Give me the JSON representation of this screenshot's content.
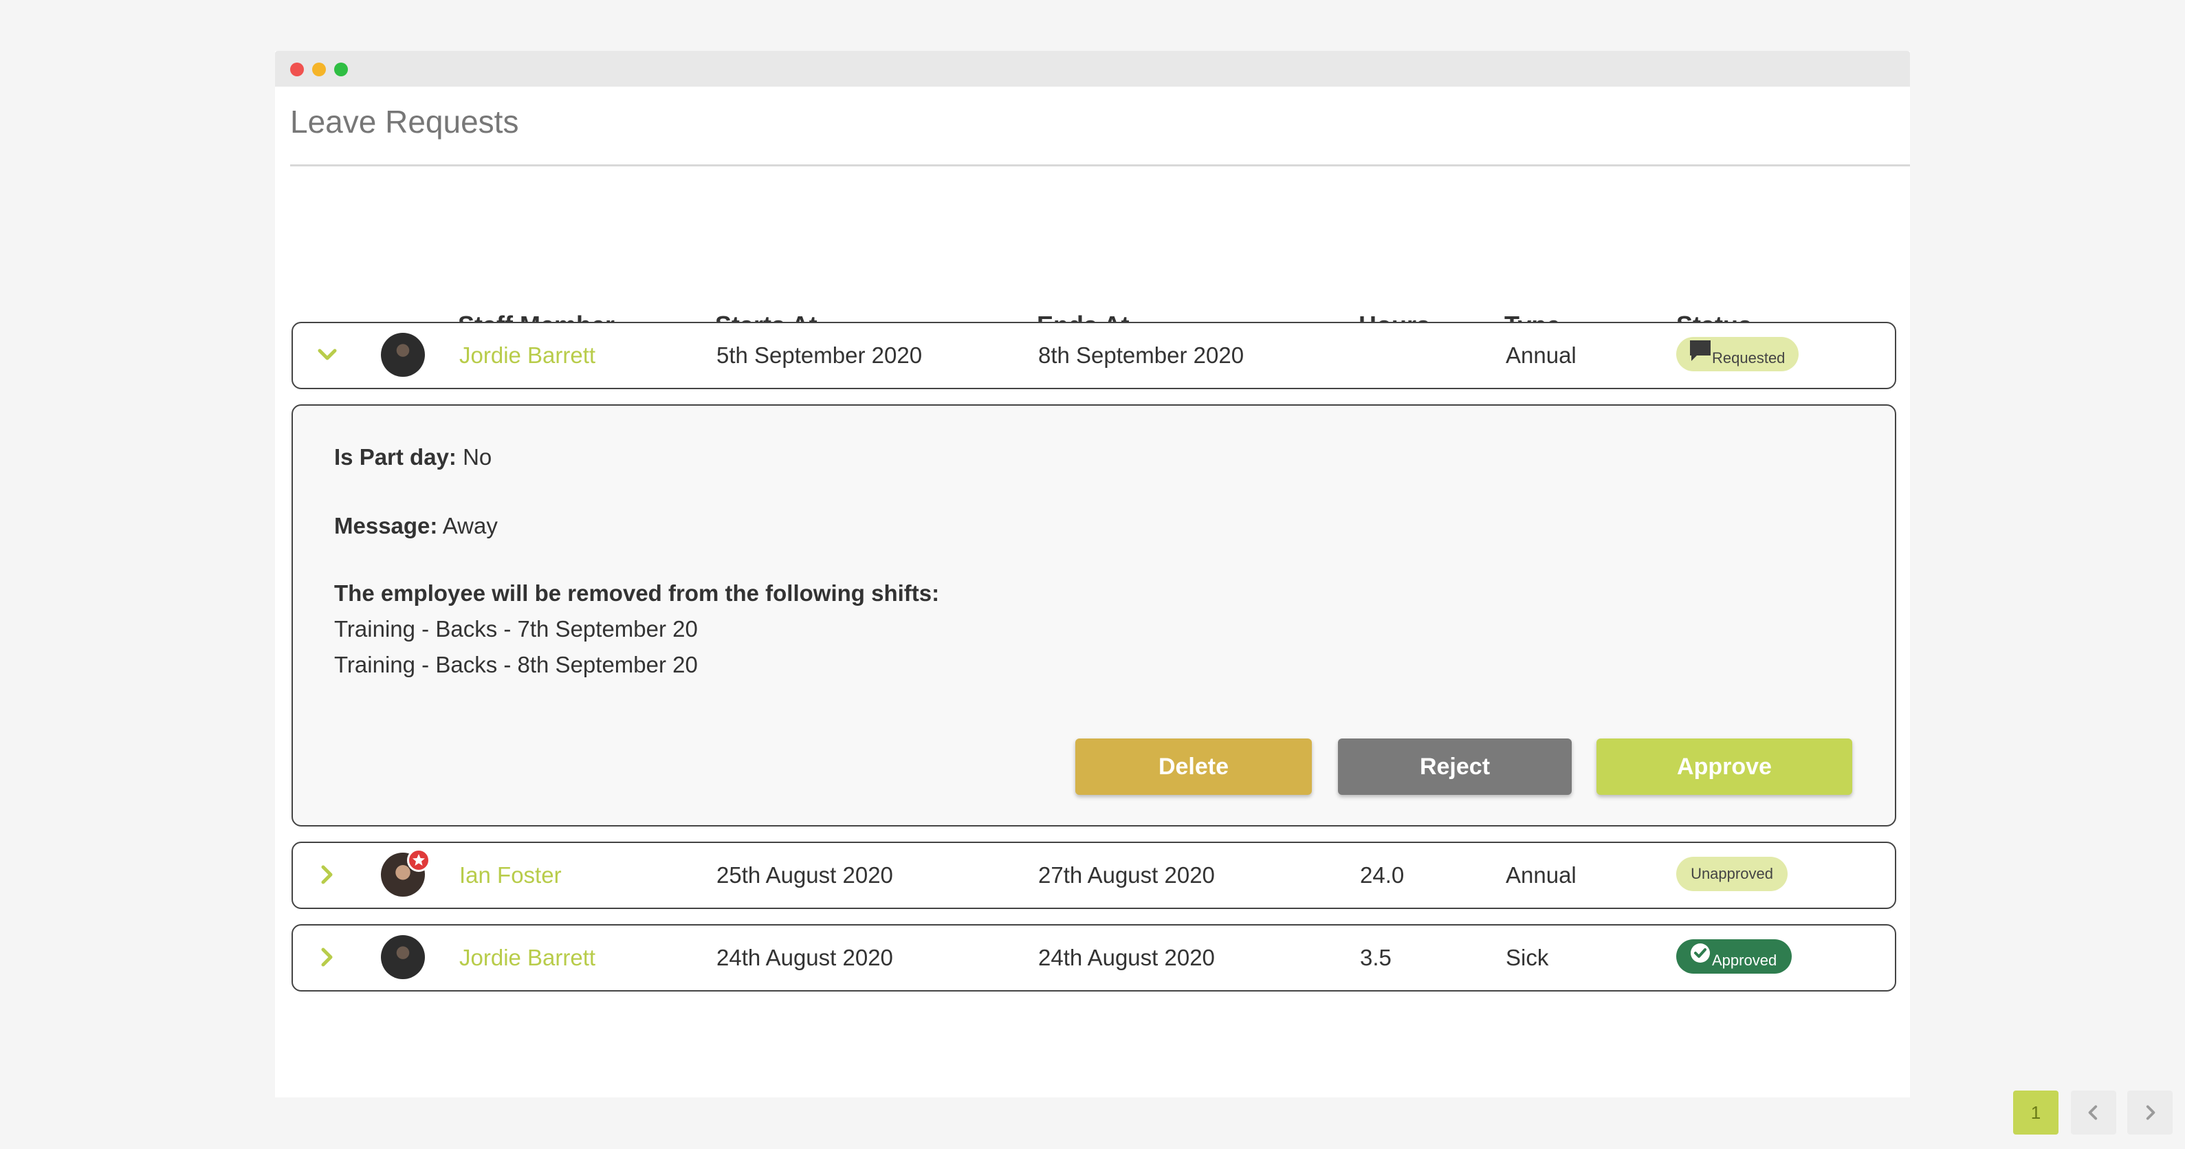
{
  "app": {
    "page_title": "Leave Requests"
  },
  "columns": {
    "staff_member": "Staff Member",
    "starts_at": "Starts At",
    "ends_at": "Ends At",
    "hours": "Hours",
    "type": "Type",
    "status": "Status"
  },
  "rows": [
    {
      "expanded": true,
      "staff": "Jordie Barrett",
      "starts": "5th September 2020",
      "ends": "8th September 2020",
      "hours": "",
      "type": "Annual",
      "status": "Requested",
      "status_icon": "speech-bubble-icon"
    },
    {
      "expanded": false,
      "staff": "Ian Foster",
      "starts": "25th August 2020",
      "ends": "27th August 2020",
      "hours": "24.0",
      "type": "Annual",
      "status": "Unapproved",
      "avatar_badge": "star-icon"
    },
    {
      "expanded": false,
      "staff": "Jordie Barrett",
      "starts": "24th August 2020",
      "ends": "24th August 2020",
      "hours": "3.5",
      "type": "Sick",
      "status": "Approved",
      "status_icon": "check-circle-icon"
    }
  ],
  "detail": {
    "part_day_label": "Is Part day:",
    "part_day_value": "No",
    "message_label": "Message:",
    "message_value": "Away",
    "shifts_heading": "The employee will be removed from the following shifts:",
    "shifts": [
      "Training - Backs - 7th September 20",
      "Training - Backs - 8th September 20"
    ],
    "buttons": {
      "delete": "Delete",
      "reject": "Reject",
      "approve": "Approve"
    }
  },
  "pagination": {
    "current_page": "1"
  },
  "colors": {
    "accent": "#c5d655",
    "name_link": "#b8cc4a",
    "delete": "#d4b24a",
    "reject": "#7a7a7a",
    "approved_badge": "#2f7d4f",
    "requested_badge": "#e2eaa9"
  }
}
